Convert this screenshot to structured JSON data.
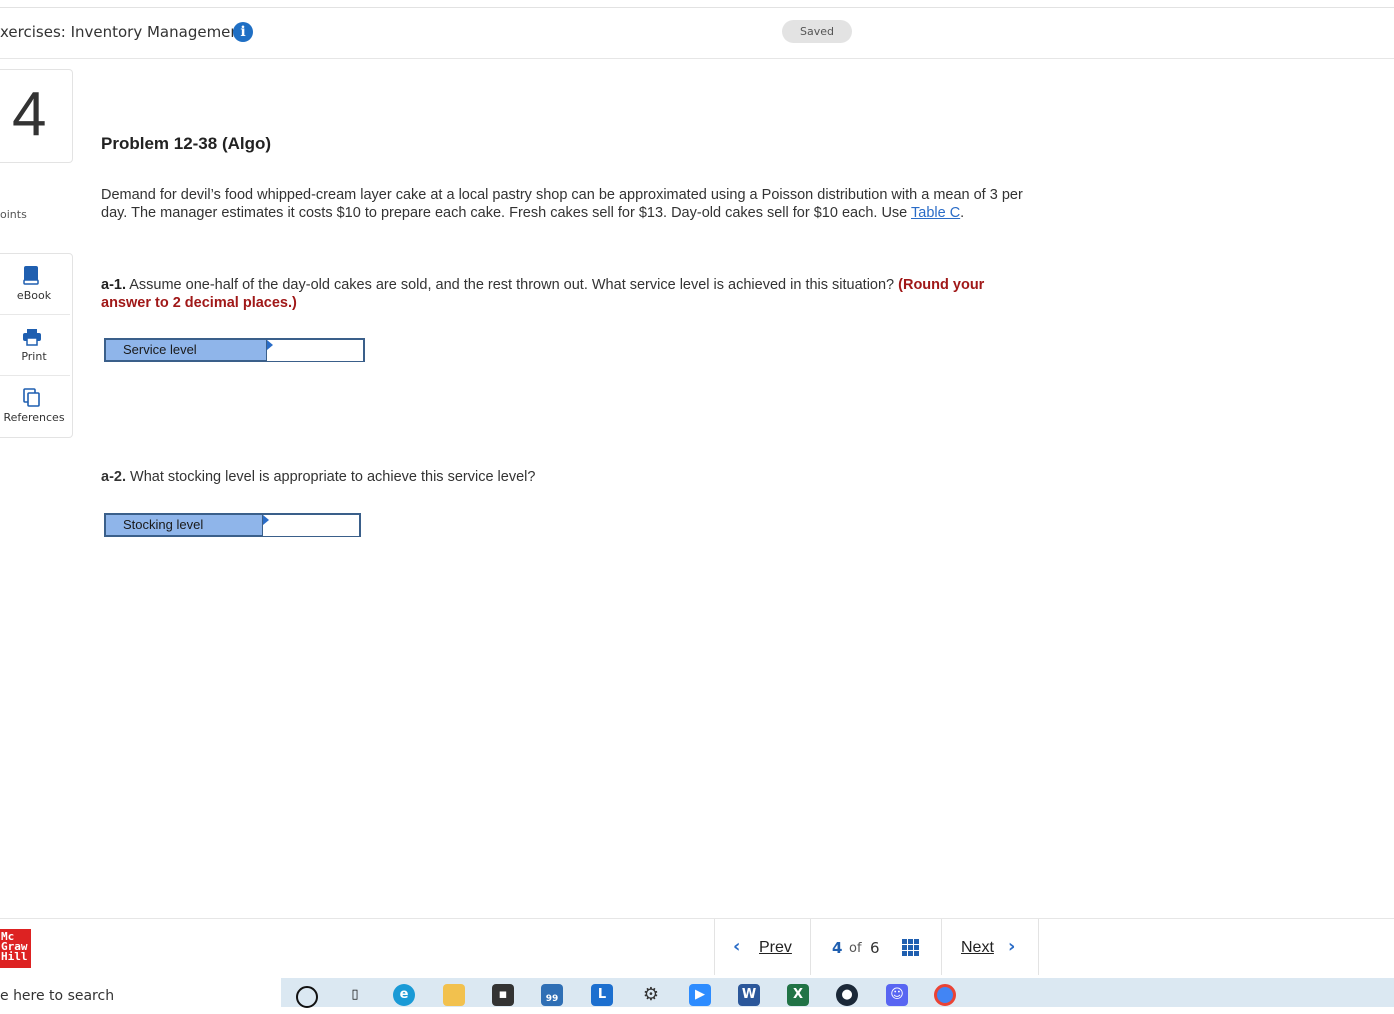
{
  "header": {
    "title": "xercises: Inventory Management",
    "status": "Saved"
  },
  "sidebar": {
    "question_number": "4",
    "points_label": "oints",
    "tools": [
      {
        "label": "eBook",
        "icon": "book-icon"
      },
      {
        "label": "Print",
        "icon": "printer-icon"
      },
      {
        "label": "References",
        "icon": "copy-icon"
      }
    ]
  },
  "problem": {
    "title": "Problem 12-38 (Algo)",
    "text": "Demand for devil’s food whipped-cream layer cake at a local pastry shop can be approximated using a Poisson distribution with a mean of 3 per day. The manager estimates it costs $10 to prepare each cake. Fresh cakes sell for $13. Day-old cakes sell for $10 each. Use ",
    "link": "Table C",
    "text_end": ".",
    "q1_label": "a-1.",
    "q1_text": " Assume one-half of the day-old cakes are sold, and the rest thrown out. What service level is achieved in this situation? ",
    "q1_instruction": "(Round your answer to 2 decimal places.)",
    "q1_field_label": "Service level",
    "q1_value": "",
    "q2_label": "a-2.",
    "q2_text": " What stocking level is appropriate to achieve this service level?",
    "q2_field_label": "Stocking level",
    "q2_value": ""
  },
  "footer": {
    "logo_lines": [
      "Mc",
      "Graw",
      "Hill"
    ],
    "prev": "Prev",
    "current": "4",
    "of": "of",
    "total": "6",
    "next": "Next"
  },
  "taskbar": {
    "search_text": "e here to search",
    "mail_badge": "99"
  }
}
